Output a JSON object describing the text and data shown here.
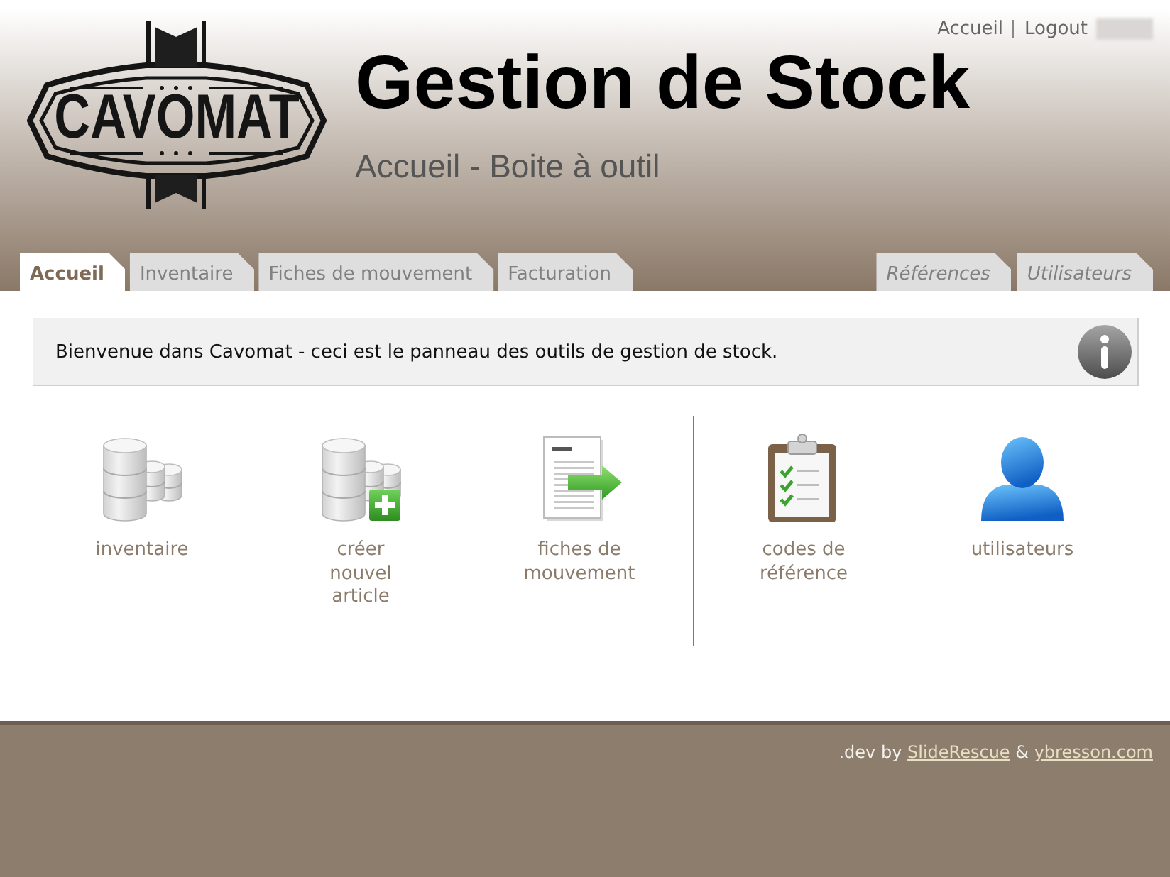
{
  "header": {
    "logo_text": "CAVOMAT",
    "title": "Gestion de Stock",
    "subtitle": "Accueil - Boite à outil",
    "top_links": [
      "Accueil",
      "Logout"
    ]
  },
  "tabs": [
    {
      "label": "Accueil",
      "selected": true
    },
    {
      "label": "Inventaire",
      "selected": false
    },
    {
      "label": "Fiches de mouvement",
      "selected": false
    },
    {
      "label": "Facturation",
      "selected": false
    }
  ],
  "right_tabs": [
    {
      "label": "Références",
      "selected": false
    },
    {
      "label": "Utilisateurs",
      "selected": false
    }
  ],
  "info_box": {
    "message": "Bienvenue dans Cavomat - ceci est le panneau des outils de gestion de stock."
  },
  "tool_groups": [
    {
      "tools": [
        {
          "kind": "database",
          "label": "inventaire"
        },
        {
          "kind": "database-add",
          "label": "créer\nnouvel\narticle"
        },
        {
          "kind": "document-arrow",
          "label": "fiches de\nmouvement"
        }
      ]
    },
    {
      "tools": [
        {
          "kind": "clipboard",
          "label": "codes de\nréférence"
        },
        {
          "kind": "user",
          "label": "utilisateurs"
        }
      ]
    }
  ],
  "footer": {
    "prefix": ".dev by",
    "links": [
      "SlideRescue",
      "ybresson.com"
    ],
    "joiner": "&"
  }
}
